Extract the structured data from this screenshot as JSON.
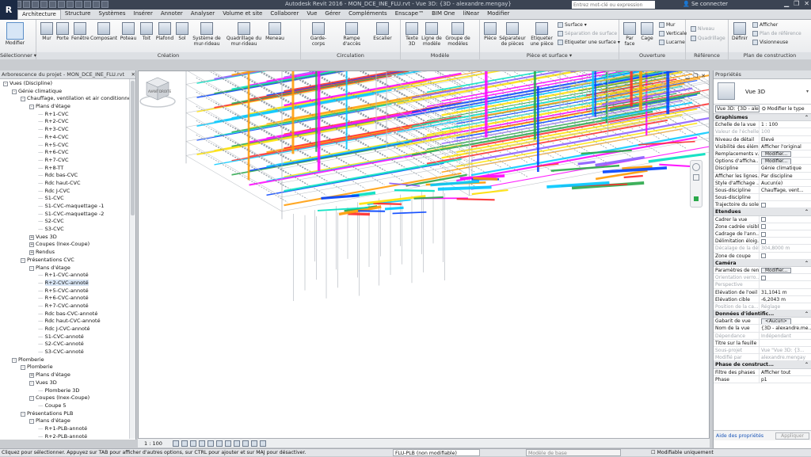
{
  "titlebar": {
    "title": "Autodesk Revit 2016 -    MON_DCE_INE_FLU.rvt - Vue 3D: {3D - alexandre.mengay}",
    "search_placeholder": "Entrez mot-clé ou expression",
    "user": "Se connecter"
  },
  "app_button": "R",
  "tabs": [
    "Architecture",
    "Structure",
    "Systèmes",
    "Insérer",
    "Annoter",
    "Analyser",
    "Volume et site",
    "Collaborer",
    "Vue",
    "Gérer",
    "Compléments",
    "Enscape™",
    "BIM One",
    "liNear",
    "Modifier"
  ],
  "ribbon": {
    "modifier": "Modifier",
    "select_label": "Sélectionner ▾",
    "creation": {
      "label": "Création",
      "buttons": [
        "Mur",
        "Porte",
        "Fenêtre",
        "Composant",
        "Poteau",
        "Toit",
        "Plafond",
        "Sol",
        "Système de mur-rideau",
        "Quadrillage du mur-rideau",
        "Meneau"
      ]
    },
    "circulation": {
      "label": "Circulation",
      "buttons": [
        "Garde-corps",
        "Rampe d'accès",
        "Escalier"
      ]
    },
    "modele": {
      "label": "Modèle",
      "buttons": [
        "Texte 3D",
        "Ligne de modèle",
        "Groupe de modèles"
      ]
    },
    "piece": {
      "label": "Pièce et surface ▾",
      "buttons": [
        "Pièce",
        "Séparateur de pièces",
        "Etiqueter une pièce"
      ],
      "small": [
        "Surface ▾",
        "Séparation de surface",
        "Etiqueter une surface ▾"
      ]
    },
    "ouverture": {
      "label": "Ouverture",
      "buttons": [
        "Par face",
        "Cage"
      ],
      "small": [
        "Mur",
        "Verticale",
        "Lucarne"
      ]
    },
    "reference": {
      "label": "Référence",
      "small": [
        "Niveau",
        "Quadrillage"
      ]
    },
    "plan": {
      "label": "Plan de construction",
      "button": "Définir",
      "small": [
        "Afficher",
        "Plan de référence",
        "Visionneuse"
      ]
    }
  },
  "browser": {
    "title": "Arborescence du projet - MON_DCE_INE_FLU.rvt",
    "tree": [
      {
        "label": "Vues (Discipline)",
        "level": 0,
        "toggle": "-"
      },
      {
        "label": "Génie climatique",
        "level": 1,
        "toggle": "-"
      },
      {
        "label": "Chauffage, ventilation et air conditionné",
        "level": 2,
        "toggle": "-"
      },
      {
        "label": "Plans d'étage",
        "level": 3,
        "toggle": "-"
      },
      {
        "label": "R+1-CVC",
        "level": 4
      },
      {
        "label": "R+2-CVC",
        "level": 4
      },
      {
        "label": "R+3-CVC",
        "level": 4
      },
      {
        "label": "R+4-CVC",
        "level": 4
      },
      {
        "label": "R+5-CVC",
        "level": 4
      },
      {
        "label": "R+6-CVC",
        "level": 4
      },
      {
        "label": "R+7-CVC",
        "level": 4
      },
      {
        "label": "R+8-TT",
        "level": 4
      },
      {
        "label": "Rdc bas-CVC",
        "level": 4
      },
      {
        "label": "Rdc haut-CVC",
        "level": 4
      },
      {
        "label": "Rdc J-CVC",
        "level": 4
      },
      {
        "label": "S1-CVC",
        "level": 4
      },
      {
        "label": "S1-CVC-maquettage -1",
        "level": 4
      },
      {
        "label": "S1-CVC-maquettage -2",
        "level": 4
      },
      {
        "label": "S2-CVC",
        "level": 4
      },
      {
        "label": "S3-CVC",
        "level": 4
      },
      {
        "label": "Vues 3D",
        "level": 3,
        "toggle": "+"
      },
      {
        "label": "Coupes (Inex-Coupe)",
        "level": 3,
        "toggle": "+"
      },
      {
        "label": "Rendus",
        "level": 3,
        "toggle": "+"
      },
      {
        "label": "Présentations CVC",
        "level": 2,
        "toggle": "-"
      },
      {
        "label": "Plans d'étage",
        "level": 3,
        "toggle": "-"
      },
      {
        "label": "R+1-CVC-annoté",
        "level": 4
      },
      {
        "label": "R+2-CVC-annoté",
        "level": 4,
        "selected": true
      },
      {
        "label": "R+5-CVC-annoté",
        "level": 4
      },
      {
        "label": "R+6-CVC-annoté",
        "level": 4
      },
      {
        "label": "R+7-CVC-annoté",
        "level": 4
      },
      {
        "label": "Rdc bas-CVC-annoté",
        "level": 4
      },
      {
        "label": "Rdc haut-CVC-annoté",
        "level": 4
      },
      {
        "label": "Rdc J-CVC-annoté",
        "level": 4
      },
      {
        "label": "S1-CVC-annoté",
        "level": 4
      },
      {
        "label": "S2-CVC-annoté",
        "level": 4
      },
      {
        "label": "S3-CVC-annoté",
        "level": 4
      },
      {
        "label": "Plomberie",
        "level": 1,
        "toggle": "-"
      },
      {
        "label": "Plomberie",
        "level": 2,
        "toggle": "-"
      },
      {
        "label": "Plans d'étage",
        "level": 3,
        "toggle": "+"
      },
      {
        "label": "Vues 3D",
        "level": 3,
        "toggle": "-"
      },
      {
        "label": "Plomberie 3D",
        "level": 4
      },
      {
        "label": "Coupes (Inex-Coupe)",
        "level": 3,
        "toggle": "-"
      },
      {
        "label": "Coupe 5",
        "level": 4
      },
      {
        "label": "Présentations PLB",
        "level": 2,
        "toggle": "-"
      },
      {
        "label": "Plans d'étage",
        "level": 3,
        "toggle": "-"
      },
      {
        "label": "R+1-PLB-annoté",
        "level": 4
      },
      {
        "label": "R+2-PLB-annoté",
        "level": 4
      }
    ]
  },
  "viewport": {
    "view_scale": "1 : 100",
    "viewcube_front": "AVANT",
    "viewcube_right": "DROITE"
  },
  "properties": {
    "title": "Propriétés",
    "type_name": "Vue 3D",
    "filter_value": "Vue 3D: {3D - ale",
    "edit_type": "Modifier le type",
    "sections": [
      {
        "name": "Graphismes",
        "rows": [
          {
            "k": "Echelle de la vue",
            "v": "1 : 100"
          },
          {
            "k": "Valeur de l'échelle...",
            "v": "100",
            "dis": true
          },
          {
            "k": "Niveau de détail",
            "v": "Elevé"
          },
          {
            "k": "Visibilité des élém...",
            "v": "Afficher l'original"
          },
          {
            "k": "Remplacements v...",
            "btn": "Modifier..."
          },
          {
            "k": "Options d'afficha...",
            "btn": "Modifier..."
          },
          {
            "k": "Discipline",
            "v": "Génie climatique"
          },
          {
            "k": "Afficher les lignes...",
            "v": "Par discipline"
          },
          {
            "k": "Style d'affichage ...",
            "v": "Aucun(e)"
          },
          {
            "k": "Sous-discipline",
            "v": "Chauffage, vent..."
          },
          {
            "k": "Sous-discipline",
            "v": ""
          },
          {
            "k": "Trajectoire du soleil",
            "cb": true
          }
        ]
      },
      {
        "name": "Etendues",
        "rows": [
          {
            "k": "Cadrer la vue",
            "cb": true
          },
          {
            "k": "Zone cadrée visible",
            "cb": true
          },
          {
            "k": "Cadrage de l'ann...",
            "cb": true
          },
          {
            "k": "Délimitation éloig...",
            "cb": true
          },
          {
            "k": "Décalage de la dél...",
            "v": "304,8000 m",
            "dis": true
          },
          {
            "k": "Zone de coupe",
            "cb": true
          }
        ]
      },
      {
        "name": "Caméra",
        "rows": [
          {
            "k": "Paramètres de ren...",
            "btn": "Modifier..."
          },
          {
            "k": "Orientation verro...",
            "cb": true,
            "dis": true
          },
          {
            "k": "Perspective",
            "v": "",
            "dis": true
          },
          {
            "k": "Elévation de l'oeil",
            "v": "31,1041 m"
          },
          {
            "k": "Elévation cible",
            "v": "-6,2043 m"
          },
          {
            "k": "Position de la ca...",
            "v": "Réglage",
            "dis": true
          }
        ]
      },
      {
        "name": "Données d'identific...",
        "rows": [
          {
            "k": "Gabarit de vue",
            "btn": "<Aucun>"
          },
          {
            "k": "Nom de la vue",
            "v": "{3D - alexandre.me..."
          },
          {
            "k": "Dépendance",
            "v": "Indépendant",
            "dis": true
          },
          {
            "k": "Titre sur la feuille",
            "v": ""
          },
          {
            "k": "Sous-projet",
            "v": "Vue \"Vue 3D: {3...",
            "dis": true
          },
          {
            "k": "Modifié par",
            "v": "alexandre.mengay",
            "dis": true
          }
        ]
      },
      {
        "name": "Phase de construct...",
        "rows": [
          {
            "k": "Filtre des phases",
            "v": "Afficher tout"
          },
          {
            "k": "Phase",
            "v": "p1"
          }
        ]
      }
    ],
    "help_link": "Aide des propriétés",
    "apply": "Appliquer"
  },
  "statusbar": {
    "message": "Cliquez pour sélectionner. Appuyez sur TAB pour afficher d'autres options, sur CTRL pour ajouter et sur MAJ pour désactiver.",
    "workset": "FLU-PLB (non modifiable)",
    "model": "Modèle de base",
    "editable": "Modifiable uniquement"
  },
  "colors": {
    "accent": "#1b2a44",
    "selection": "#d9e6f5",
    "pipe_colors": [
      "#ff00ff",
      "#00c8ff",
      "#ff9a00",
      "#2aa84a",
      "#ffe100",
      "#0040ff",
      "#ff2a2a",
      "#8a5cff",
      "#00e0c0"
    ]
  }
}
